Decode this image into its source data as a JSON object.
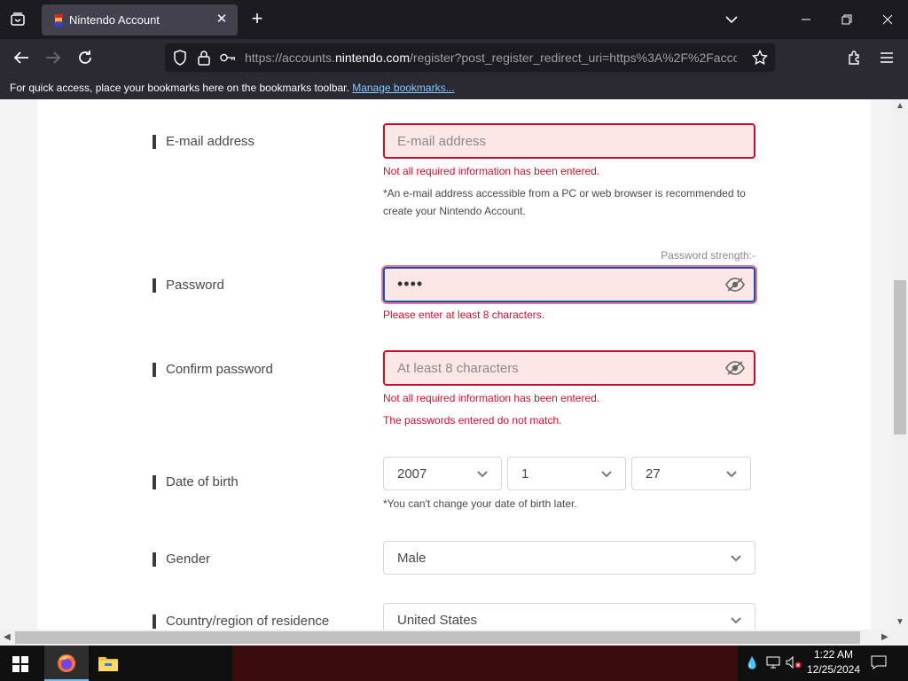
{
  "browser": {
    "tab_title": "Nintendo Account",
    "url_prefix": "https://accounts.",
    "url_domain": "nintendo.com",
    "url_rest": "/register?post_register_redirect_uri=https%3A%2F%2Faccoun",
    "bookmarks_text": "For quick access, place your bookmarks here on the bookmarks toolbar.",
    "bookmarks_link": "Manage bookmarks..."
  },
  "form": {
    "email": {
      "label": "E-mail address",
      "placeholder": "E-mail address",
      "error": "Not all required information has been entered.",
      "note": "*An e-mail address accessible from a PC or web browser is recommended to create your Nintendo Account."
    },
    "password": {
      "label": "Password",
      "strength_label": "Password strength:-",
      "value": "••••",
      "error": "Please enter at least 8 characters."
    },
    "confirm": {
      "label": "Confirm password",
      "placeholder": "At least 8 characters",
      "error1": "Not all required information has been entered.",
      "error2": "The passwords entered do not match."
    },
    "dob": {
      "label": "Date of birth",
      "year": "2007",
      "month": "1",
      "day": "27",
      "note": "*You can't change your date of birth later."
    },
    "gender": {
      "label": "Gender",
      "value": "Male"
    },
    "country": {
      "label": "Country/region of residence",
      "value": "United States"
    }
  },
  "taskbar": {
    "time": "1:22 AM",
    "date": "12/25/2024"
  },
  "colors": {
    "error": "#c8102e",
    "error_bg": "#fde6e6",
    "focus": "#1f4fa8"
  }
}
